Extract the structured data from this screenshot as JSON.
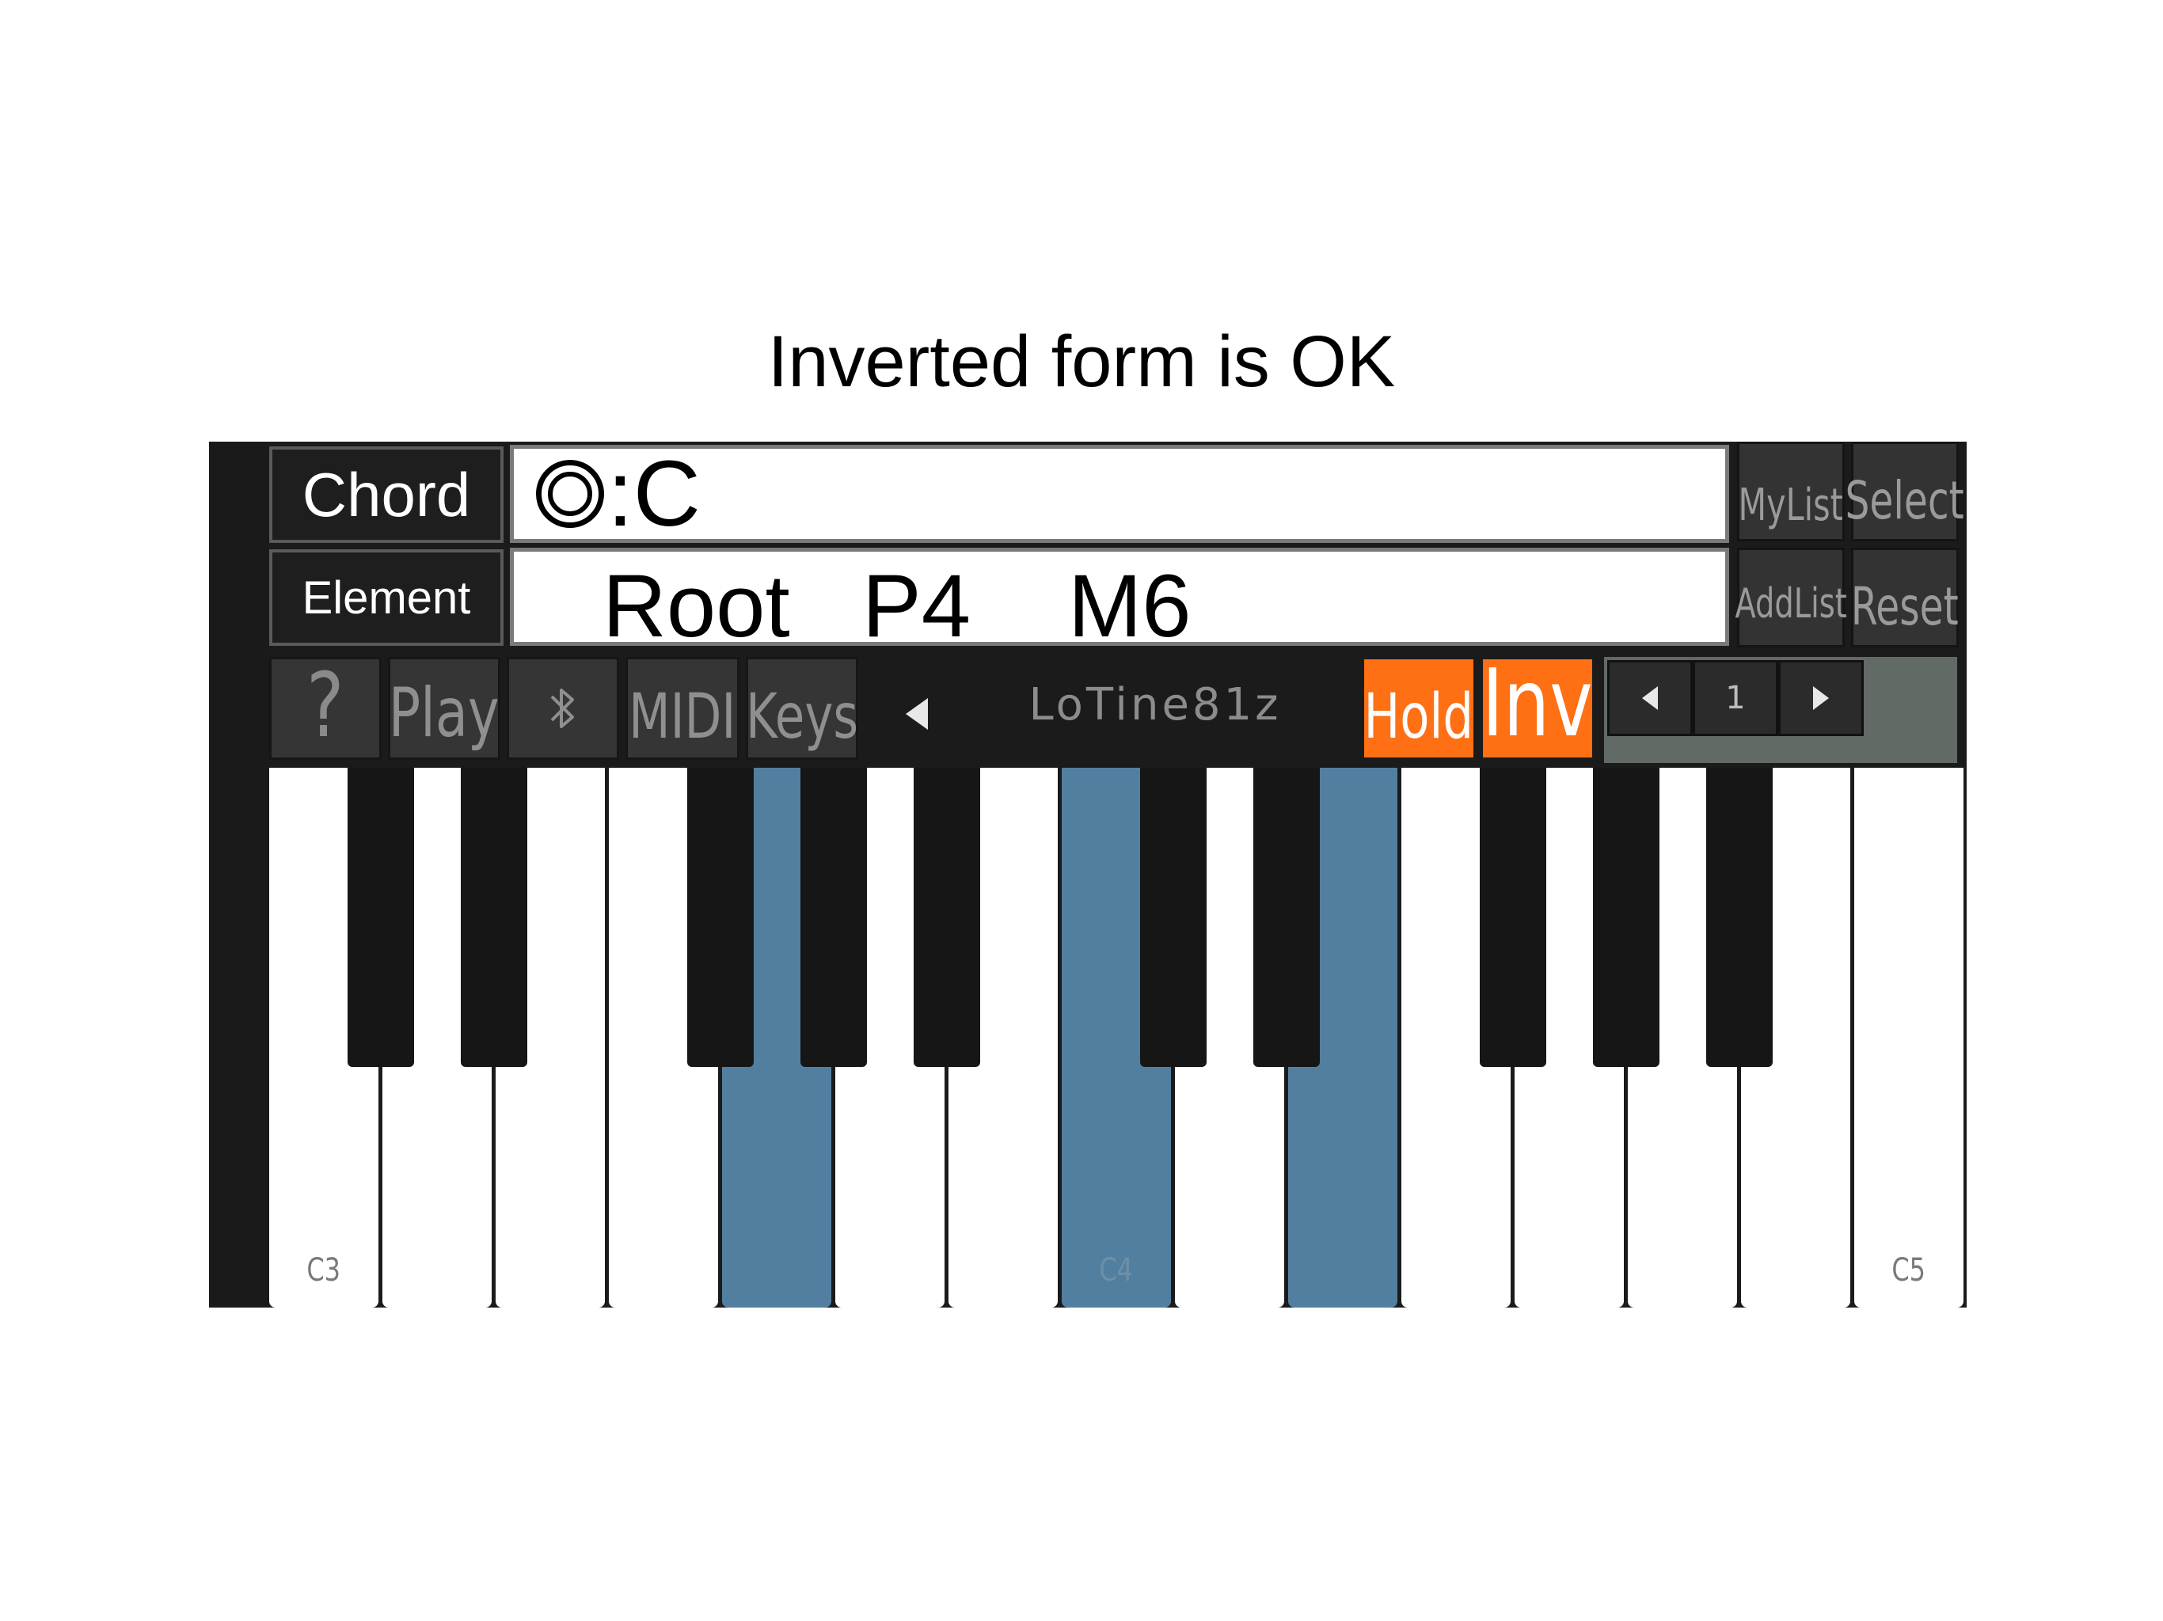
{
  "caption": "Inverted form is OK",
  "chord": {
    "label": "Chord",
    "symbol_icon": "double-circle-icon",
    "value": ":C"
  },
  "element": {
    "label": "Element",
    "values": [
      "Root",
      "P4",
      "M6"
    ]
  },
  "side_buttons": {
    "mylist": "MyList",
    "select": "Select",
    "addlist": "AddList",
    "reset": "Reset"
  },
  "toolbar": {
    "help": "?",
    "play": "Play",
    "bluetooth_icon": "bluetooth-icon",
    "midi": "MIDI",
    "keys": "Keys",
    "preset": "LoTine81z",
    "hold": "Hold",
    "inv": "Inv",
    "stepper_value": "1"
  },
  "keyboard": {
    "white_keys": [
      {
        "note": "C3",
        "label": "C3",
        "on": false
      },
      {
        "note": "D3",
        "label": "",
        "on": false
      },
      {
        "note": "E3",
        "label": "",
        "on": false
      },
      {
        "note": "F3",
        "label": "",
        "on": false
      },
      {
        "note": "G3",
        "label": "",
        "on": true
      },
      {
        "note": "A3",
        "label": "",
        "on": false
      },
      {
        "note": "B3",
        "label": "",
        "on": false
      },
      {
        "note": "C4",
        "label": "C4",
        "on": true
      },
      {
        "note": "D4",
        "label": "",
        "on": false
      },
      {
        "note": "E4",
        "label": "",
        "on": true
      },
      {
        "note": "F4",
        "label": "",
        "on": false
      },
      {
        "note": "G4",
        "label": "",
        "on": false
      },
      {
        "note": "A4",
        "label": "",
        "on": false
      },
      {
        "note": "B4",
        "label": "",
        "on": false
      },
      {
        "note": "C5",
        "label": "C5",
        "on": false
      }
    ],
    "black_keys": [
      "C#3",
      "D#3",
      "F#3",
      "G#3",
      "A#3",
      "C#4",
      "D#4",
      "F#4",
      "G#4",
      "A#4"
    ],
    "highlight_color": "#527f9f"
  },
  "colors": {
    "accent_orange": "#ff6f14",
    "panel": "#1b1b1b"
  }
}
